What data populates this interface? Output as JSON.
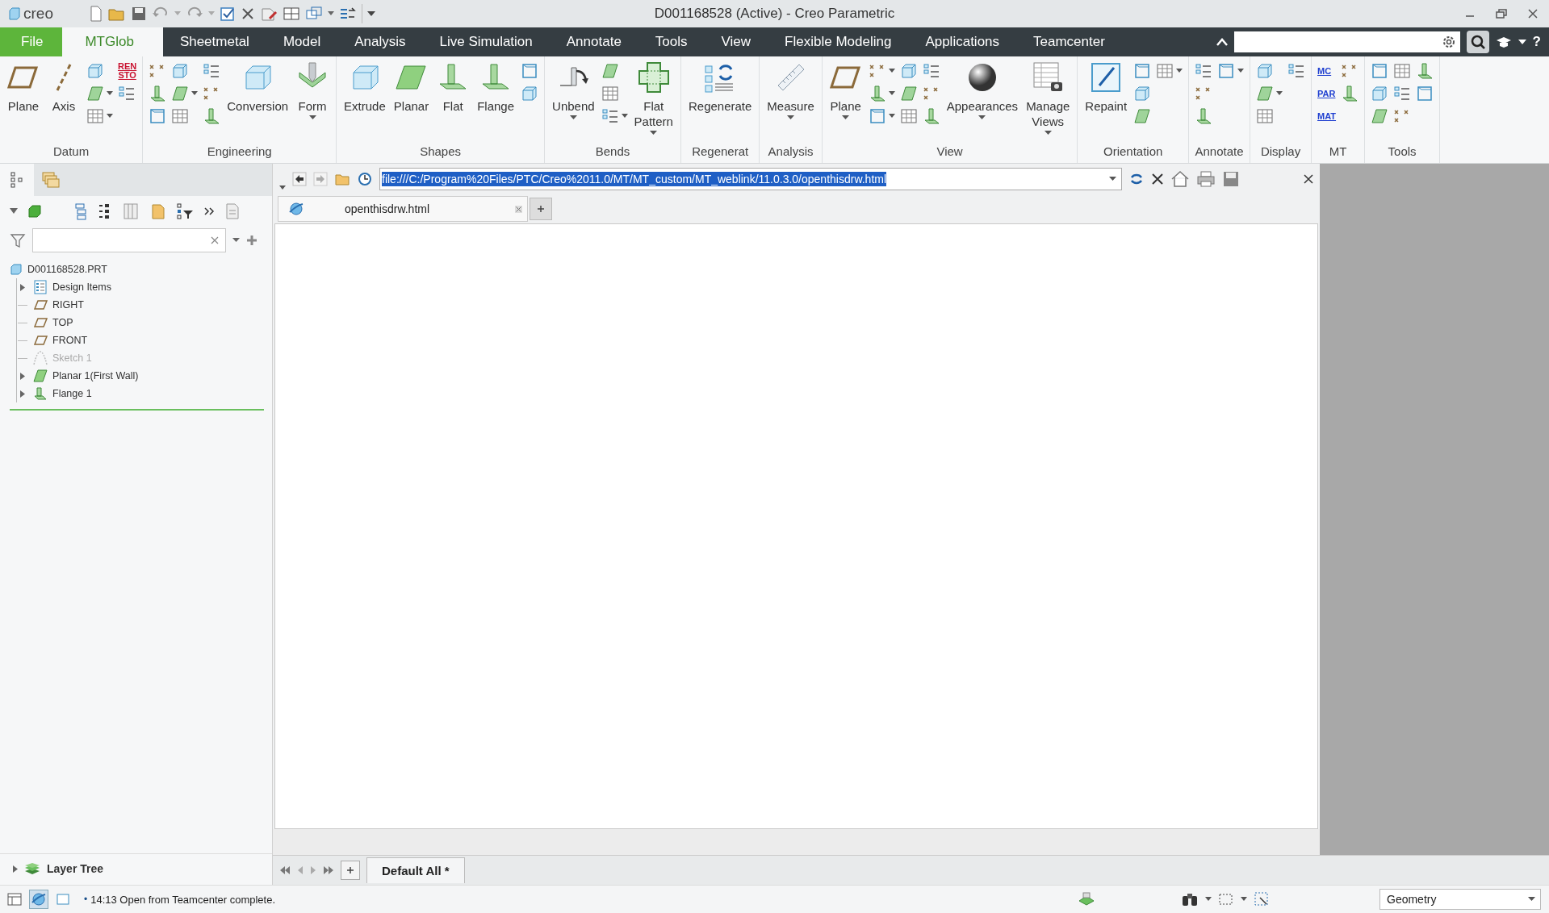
{
  "title_bar": {
    "logo": "creo",
    "title": "D001168528 (Active) - Creo Parametric"
  },
  "tabs": [
    {
      "label": "File",
      "kind": "file",
      "selected": false
    },
    {
      "label": "MTGlob",
      "kind": "tab",
      "selected": true
    },
    {
      "label": "Sheetmetal",
      "kind": "tab",
      "selected": false
    },
    {
      "label": "Model",
      "kind": "tab",
      "selected": false
    },
    {
      "label": "Analysis",
      "kind": "tab",
      "selected": false
    },
    {
      "label": "Live Simulation",
      "kind": "tab",
      "selected": false
    },
    {
      "label": "Annotate",
      "kind": "tab",
      "selected": false
    },
    {
      "label": "Tools",
      "kind": "tab",
      "selected": false
    },
    {
      "label": "View",
      "kind": "tab",
      "selected": false
    },
    {
      "label": "Flexible Modeling",
      "kind": "tab",
      "selected": false
    },
    {
      "label": "Applications",
      "kind": "tab",
      "selected": false
    },
    {
      "label": "Teamcenter",
      "kind": "tab",
      "selected": false
    }
  ],
  "help": "?",
  "ribbon": {
    "groups": [
      {
        "label": "Datum",
        "items": [
          {
            "kind": "large",
            "label": "Plane",
            "caret": false
          },
          {
            "kind": "large",
            "label": "Axis",
            "caret": false
          },
          {
            "kind": "small",
            "caret": false
          },
          {
            "kind": "small",
            "caret": true
          },
          {
            "kind": "small",
            "caret": true
          },
          {
            "kind": "text",
            "label": "REN\nSTO",
            "color": "#c8102e",
            "caret": false
          },
          {
            "kind": "small",
            "caret": false
          }
        ]
      },
      {
        "label": "Engineering",
        "items": [
          {
            "kind": "small",
            "caret": false
          },
          {
            "kind": "small",
            "caret": false
          },
          {
            "kind": "small",
            "caret": false
          },
          {
            "kind": "small",
            "caret": false
          },
          {
            "kind": "small",
            "caret": true
          },
          {
            "kind": "small",
            "caret": false
          },
          {
            "kind": "small",
            "caret": false
          },
          {
            "kind": "small",
            "caret": false
          },
          {
            "kind": "small",
            "caret": false
          },
          {
            "kind": "large",
            "label": "Conversion",
            "caret": false
          },
          {
            "kind": "large",
            "label": "Form",
            "caret": true
          }
        ]
      },
      {
        "label": "Shapes",
        "items": [
          {
            "kind": "large",
            "label": "Extrude",
            "caret": false
          },
          {
            "kind": "large",
            "label": "Planar",
            "caret": false
          },
          {
            "kind": "large",
            "label": "Flat",
            "caret": false
          },
          {
            "kind": "large",
            "label": "Flange",
            "caret": false
          },
          {
            "kind": "small",
            "caret": false
          },
          {
            "kind": "small",
            "caret": false
          }
        ]
      },
      {
        "label": "Bends",
        "items": [
          {
            "kind": "large",
            "label": "Unbend",
            "caret": true
          },
          {
            "kind": "small",
            "caret": false
          },
          {
            "kind": "small",
            "caret": false
          },
          {
            "kind": "small",
            "caret": true
          },
          {
            "kind": "large",
            "label": "Flat Pattern",
            "caret": true
          }
        ]
      },
      {
        "label": "Regenerat",
        "items": [
          {
            "kind": "large",
            "label": "Regenerate",
            "caret": false
          }
        ]
      },
      {
        "label": "Analysis",
        "items": [
          {
            "kind": "large",
            "label": "Measure",
            "caret": true
          }
        ]
      },
      {
        "label": "View",
        "items": [
          {
            "kind": "large",
            "label": "Plane",
            "caret": true
          },
          {
            "kind": "small",
            "caret": true
          },
          {
            "kind": "small",
            "caret": true
          },
          {
            "kind": "small",
            "caret": true
          },
          {
            "kind": "small",
            "caret": false
          },
          {
            "kind": "small",
            "caret": false
          },
          {
            "kind": "small",
            "caret": false
          },
          {
            "kind": "small",
            "caret": false
          },
          {
            "kind": "small",
            "caret": false
          },
          {
            "kind": "small",
            "caret": false
          },
          {
            "kind": "large",
            "label": "Appearances",
            "caret": true
          },
          {
            "kind": "large",
            "label": "Manage Views",
            "caret": true
          }
        ]
      },
      {
        "label": "Orientation",
        "items": [
          {
            "kind": "large",
            "label": "Repaint",
            "caret": false
          },
          {
            "kind": "small",
            "caret": false
          },
          {
            "kind": "small",
            "caret": false
          },
          {
            "kind": "small",
            "caret": false
          },
          {
            "kind": "small",
            "caret": true
          }
        ]
      },
      {
        "label": "Annotate",
        "items": [
          {
            "kind": "small",
            "caret": false
          },
          {
            "kind": "small",
            "caret": false
          },
          {
            "kind": "small",
            "caret": false
          },
          {
            "kind": "small",
            "caret": true
          }
        ]
      },
      {
        "label": "Display",
        "items": [
          {
            "kind": "small",
            "caret": false
          },
          {
            "kind": "small",
            "caret": true
          },
          {
            "kind": "small",
            "caret": false
          },
          {
            "kind": "small",
            "caret": false
          }
        ]
      },
      {
        "label": "MT",
        "items": [
          {
            "kind": "text",
            "label": "MC",
            "color": "#1f3fd0",
            "caret": false
          },
          {
            "kind": "text",
            "label": "PAR",
            "color": "#1f3fd0",
            "caret": false
          },
          {
            "kind": "text",
            "label": "MAT",
            "color": "#1f3fd0",
            "caret": false
          },
          {
            "kind": "small",
            "caret": false
          },
          {
            "kind": "small",
            "caret": false
          }
        ]
      },
      {
        "label": "Tools",
        "items": [
          {
            "kind": "small",
            "caret": false
          },
          {
            "kind": "small",
            "caret": false
          },
          {
            "kind": "small",
            "caret": false
          },
          {
            "kind": "small",
            "caret": false
          },
          {
            "kind": "small",
            "caret": false
          },
          {
            "kind": "small",
            "caret": false
          },
          {
            "kind": "small",
            "caret": false
          },
          {
            "kind": "small",
            "caret": false
          }
        ]
      }
    ]
  },
  "tree": {
    "label": "D001168528.PRT",
    "children": [
      {
        "label": "Design Items",
        "kind": "design_items",
        "expandable": true,
        "dimmed": false
      },
      {
        "label": "RIGHT",
        "kind": "datum_plane",
        "expandable": false,
        "dimmed": false
      },
      {
        "label": "TOP",
        "kind": "datum_plane",
        "expandable": false,
        "dimmed": false
      },
      {
        "label": "FRONT",
        "kind": "datum_plane",
        "expandable": false,
        "dimmed": false
      },
      {
        "label": "Sketch 1",
        "kind": "sketch",
        "expandable": false,
        "dimmed": true
      },
      {
        "label": "Planar 1(First Wall)",
        "kind": "wall",
        "expandable": true,
        "dimmed": false
      },
      {
        "label": "Flange 1",
        "kind": "flange",
        "expandable": true,
        "dimmed": false
      }
    ]
  },
  "layer_tree": {
    "label": "Layer Tree"
  },
  "browser": {
    "url": "file:///C:/Program%20Files/PTC/Creo%2011.0/MT/MT_custom/MT_weblink/11.0.3.0/openthisdrw.html",
    "url_selected": true,
    "tabs": [
      {
        "label": "openthisdrw.html",
        "selected": true
      }
    ]
  },
  "window_tabs": [
    {
      "label": "Default All *",
      "selected": true
    }
  ],
  "status": {
    "bullet": "•",
    "message": "14:13 Open from Teamcenter complete.",
    "filter": "Geometry"
  }
}
